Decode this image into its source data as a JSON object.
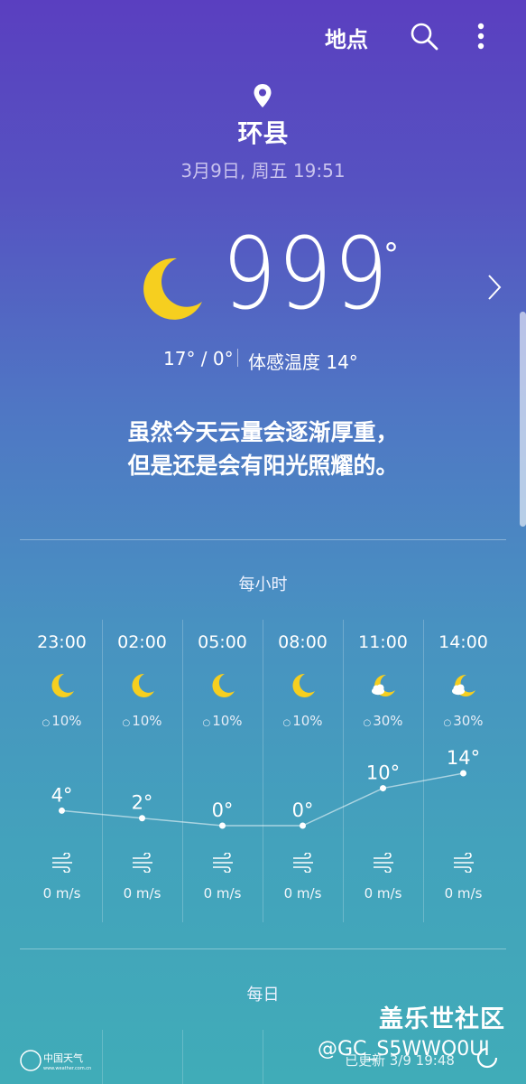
{
  "topbar": {
    "location_label": "地点",
    "search_icon": "search-icon",
    "more_icon": "more-vertical-icon"
  },
  "location": {
    "city": "环县",
    "datetime": "3月9日, 周五 19:51"
  },
  "current": {
    "condition_icon": "moon-icon",
    "temperature": "999",
    "degree_symbol": "°",
    "high_low": "17° / 0°",
    "feels_like": "体感温度 14°",
    "description_line1": "虽然今天云量会逐渐厚重，",
    "description_line2": "但是还是会有阳光照耀的。"
  },
  "hourly": {
    "title": "每小时",
    "items": [
      {
        "time": "23:00",
        "icon": "moon-icon",
        "precip": "10%",
        "temp": "4°",
        "temp_value": 4,
        "wind": "0 m/s"
      },
      {
        "time": "02:00",
        "icon": "moon-icon",
        "precip": "10%",
        "temp": "2°",
        "temp_value": 2,
        "wind": "0 m/s"
      },
      {
        "time": "05:00",
        "icon": "moon-icon",
        "precip": "10%",
        "temp": "0°",
        "temp_value": 0,
        "wind": "0 m/s"
      },
      {
        "time": "08:00",
        "icon": "moon-icon",
        "precip": "10%",
        "temp": "0°",
        "temp_value": 0,
        "wind": "0 m/s"
      },
      {
        "time": "11:00",
        "icon": "moon-cloud-icon",
        "precip": "30%",
        "temp": "10°",
        "temp_value": 10,
        "wind": "0 m/s"
      },
      {
        "time": "14:00",
        "icon": "moon-cloud-icon",
        "precip": "30%",
        "temp": "14°",
        "temp_value": 14,
        "wind": "0 m/s"
      }
    ]
  },
  "daily": {
    "title": "每日"
  },
  "footer": {
    "watermark_line1": "盖乐世社区",
    "watermark_line2": "@GC_S5WWO0UI",
    "updated": "已更新  3/9  19:48",
    "logo_text": "中国天气",
    "logo_url_text": "www.weather.com.cn"
  },
  "colors": {
    "moon": "#f6cf1f",
    "text": "#ffffff"
  }
}
